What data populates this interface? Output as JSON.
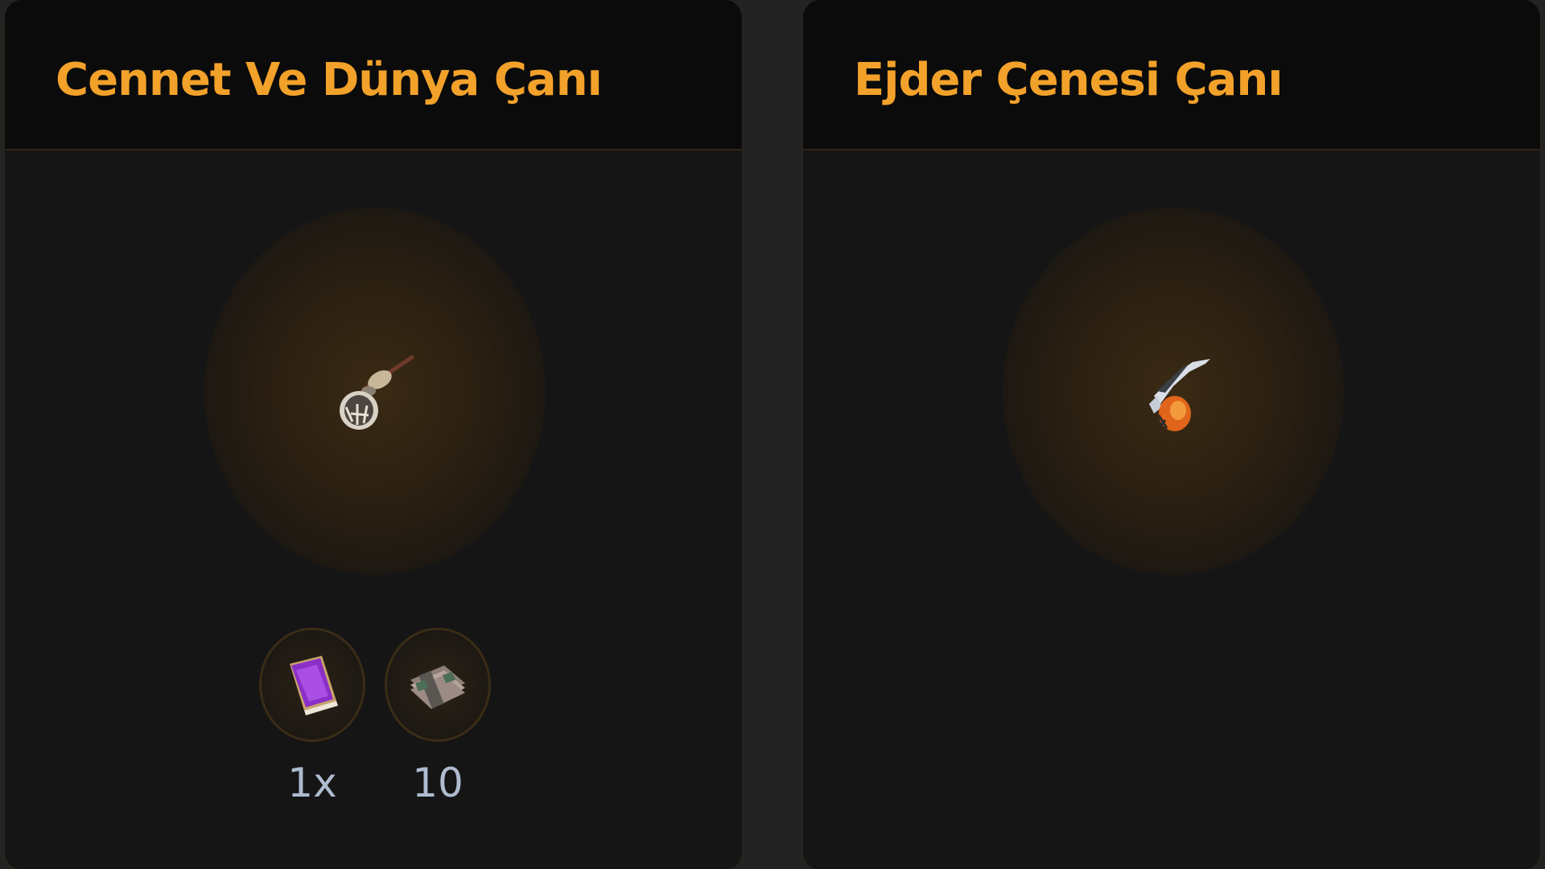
{
  "cards": [
    {
      "title": "Cennet Ve Dünya Çanı",
      "item_icon": "bell-icon",
      "materials": [
        {
          "icon": "purple-book-icon",
          "quantity": "1x"
        },
        {
          "icon": "bundle-scroll-icon",
          "quantity": "10"
        }
      ]
    },
    {
      "title": "Ejder Çenesi Çanı",
      "item_icon": "dragon-bell-icon",
      "materials": []
    }
  ],
  "colors": {
    "title": "#f2a12a",
    "quantity": "#aebbd0",
    "panel": "#151515",
    "header": "#0b0b0b",
    "border": "#2e2516"
  }
}
